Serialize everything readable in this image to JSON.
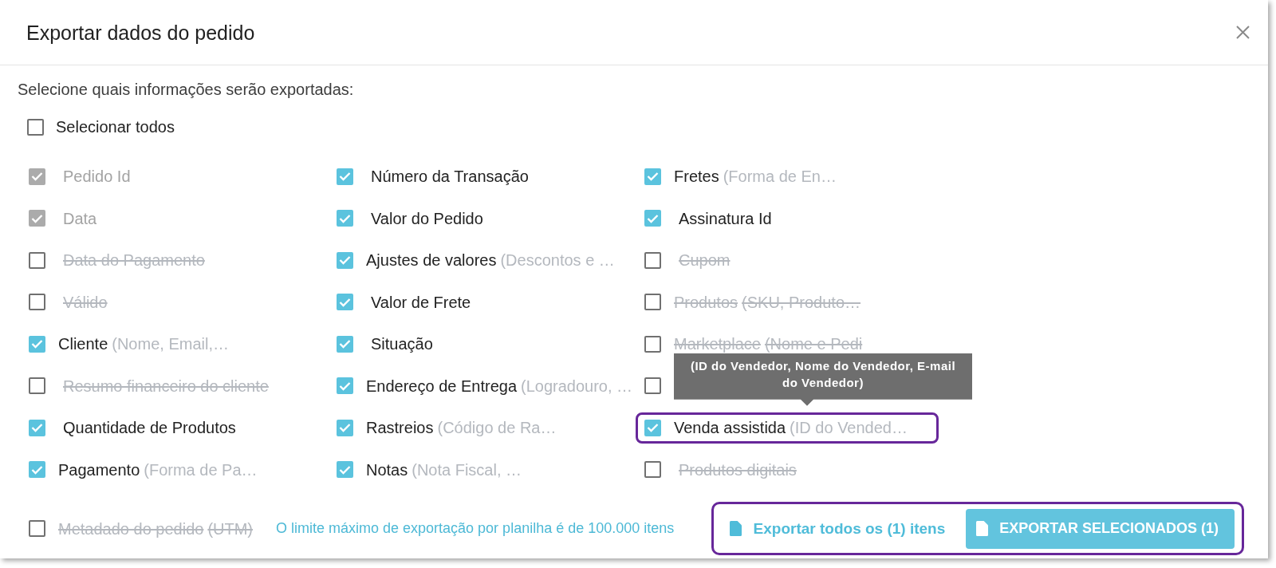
{
  "dialog": {
    "title": "Exportar dados do pedido"
  },
  "instructions": "Selecione quais informações serão exportadas:",
  "select_all": {
    "label": "Selecionar todos",
    "checked": false
  },
  "columns": [
    {
      "options": [
        {
          "label": "Pedido Id",
          "checked": true,
          "disabled": true,
          "crossed_out": false
        },
        {
          "label": "Data",
          "checked": true,
          "disabled": true,
          "crossed_out": false
        },
        {
          "label": "Data do Pagamento",
          "checked": false,
          "disabled": false,
          "crossed_out": true
        },
        {
          "label": "Válido",
          "checked": false,
          "disabled": false,
          "crossed_out": true
        },
        {
          "label": "Cliente",
          "hint": "(Nome, Email,…",
          "checked": true,
          "disabled": false,
          "crossed_out": false
        },
        {
          "label": "Resumo financeiro do cliente",
          "checked": false,
          "disabled": false,
          "crossed_out": true
        },
        {
          "label": "Quantidade de Produtos",
          "checked": true,
          "disabled": false,
          "crossed_out": false
        },
        {
          "label": "Pagamento",
          "hint": "(Forma de Pa…",
          "checked": true,
          "disabled": false,
          "crossed_out": false
        }
      ]
    },
    {
      "options": [
        {
          "label": "Número da Transação",
          "checked": true,
          "disabled": false,
          "crossed_out": false
        },
        {
          "label": "Valor do Pedido",
          "checked": true,
          "disabled": false,
          "crossed_out": false
        },
        {
          "label": "Ajustes de valores",
          "hint": "(Descontos e …",
          "checked": true,
          "disabled": false,
          "crossed_out": false
        },
        {
          "label": "Valor de Frete",
          "checked": true,
          "disabled": false,
          "crossed_out": false
        },
        {
          "label": "Situação",
          "checked": true,
          "disabled": false,
          "crossed_out": false
        },
        {
          "label": "Endereço de Entrega",
          "hint": "(Logradouro, …",
          "checked": true,
          "disabled": false,
          "crossed_out": false
        },
        {
          "label": "Rastreios",
          "hint": "(Código de Ra…",
          "checked": true,
          "disabled": false,
          "crossed_out": false
        },
        {
          "label": "Notas",
          "hint": "(Nota Fiscal, …",
          "checked": true,
          "disabled": false,
          "crossed_out": false
        }
      ]
    },
    {
      "options": [
        {
          "label": "Fretes",
          "hint": "(Forma de En…",
          "checked": true,
          "disabled": false,
          "crossed_out": false
        },
        {
          "label": "Assinatura Id",
          "checked": true,
          "disabled": false,
          "crossed_out": false
        },
        {
          "label": "Cupom",
          "checked": false,
          "disabled": false,
          "crossed_out": true
        },
        {
          "label": "Produtos",
          "hint": "(SKU, Produto…",
          "checked": false,
          "disabled": false,
          "crossed_out": true
        },
        {
          "label": "Marketplace",
          "hint": "(Nome e Pedi",
          "checked": false,
          "disabled": false,
          "crossed_out": true
        },
        {
          "checked": false,
          "disabled": false
        },
        {
          "label": "Venda assistida",
          "hint": "(ID do Vended…",
          "checked": true,
          "disabled": false,
          "crossed_out": false,
          "highlighted": true,
          "tooltip": {
            "text": "(ID do Vendedor, Nome do Vendedor, E-mail do Vendedor)"
          }
        },
        {
          "label": "Produtos digitais",
          "checked": false,
          "disabled": false,
          "crossed_out": true
        }
      ]
    }
  ],
  "footer": {
    "option": {
      "label": "Metadado do pedido",
      "hint": "(UTM)",
      "checked": false,
      "disabled": false,
      "crossed_out": true
    },
    "limit_note": "O limite máximo de exportação por planilha é de 100.000 itens",
    "actions": {
      "highlighted": true,
      "buttons": [
        {
          "kind": "text",
          "label": "Exportar todos os (1) itens"
        },
        {
          "kind": "filled",
          "label": "EXPORTAR SELECIONADOS (1)"
        }
      ]
    }
  }
}
